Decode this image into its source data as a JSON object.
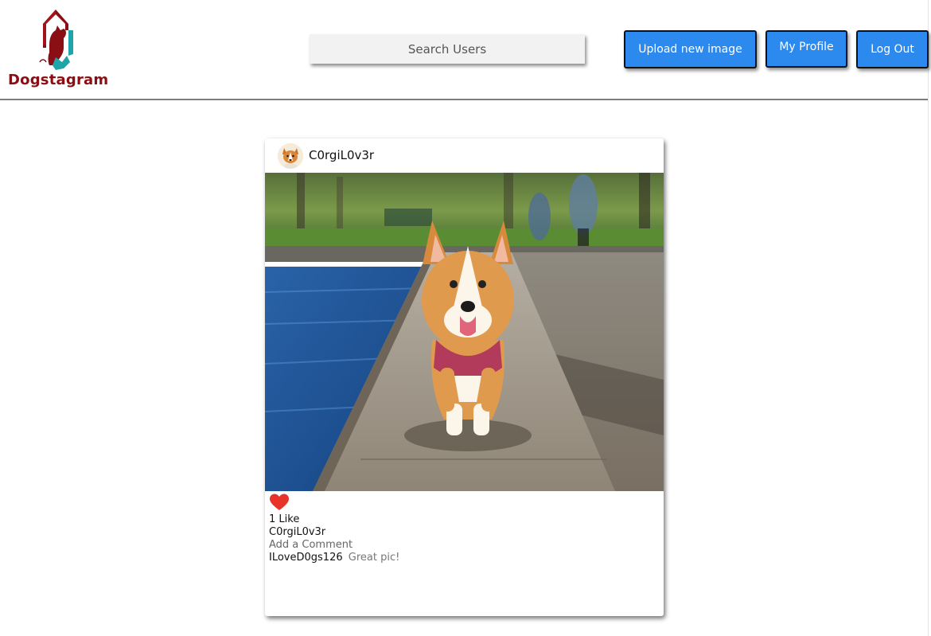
{
  "app": {
    "name": "Dogstagram"
  },
  "header": {
    "search": {
      "placeholder": "Search Users",
      "value": ""
    },
    "buttons": {
      "upload": "Upload new image",
      "profile": "My Profile",
      "logout": "Log Out"
    }
  },
  "post": {
    "author": "C0rgiL0v3r",
    "image_subject": "corgi walking on stone ledge by water",
    "liked": true,
    "likes_label": "1 Like",
    "caption_user": "C0rgiL0v3r",
    "add_comment_label": "Add a Comment",
    "comments": [
      {
        "user": "ILoveD0gs126",
        "text": "Great pic!"
      }
    ]
  },
  "colors": {
    "brand": "#8a0f14",
    "logo_teal": "#1fa4a9",
    "button_blue": "#2c89ee",
    "heart": "#e8332a"
  },
  "icons": {
    "logo": "dog-house-logo-icon",
    "like": "heart-icon",
    "avatar": "corgi-avatar"
  }
}
